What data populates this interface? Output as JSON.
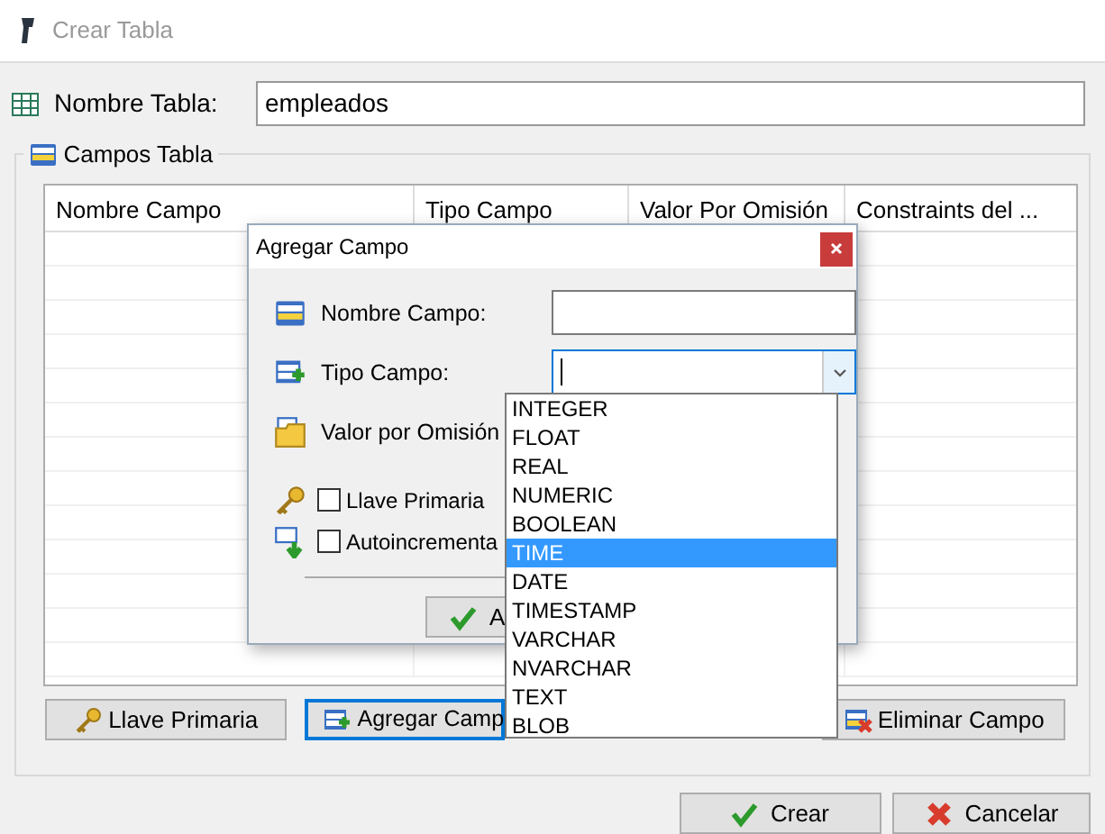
{
  "window": {
    "title": "Crear Tabla",
    "active": false
  },
  "table_name": {
    "label": "Nombre Tabla:",
    "value": "empleados"
  },
  "fields_group": {
    "title": "Campos Tabla",
    "columns": [
      "Nombre Campo",
      "Tipo Campo",
      "Valor Por Omisión",
      "Constraints del ..."
    ],
    "buttons": [
      {
        "kind": "key",
        "label": "Llave Primaria",
        "focused": false
      },
      {
        "kind": "add",
        "label": "Agregar Camp",
        "focused": true
      },
      {
        "kind": "delete",
        "label": "Eliminar Campo",
        "focused": false
      }
    ]
  },
  "buttons": [
    {
      "kind": "accept",
      "label": "Crear"
    },
    {
      "kind": "cancel",
      "label": "Cancelar"
    }
  ],
  "dialog": {
    "title": "Agregar Campo",
    "fields": [
      {
        "kind": "text",
        "label": "Nombre Campo:"
      },
      {
        "kind": "combo",
        "label": "Tipo Campo:",
        "expanded": true
      },
      {
        "kind": "default",
        "label": "Valor por Omisión"
      }
    ],
    "checkboxes": [
      {
        "kind": "key",
        "label": "Llave Primaria",
        "checked": false
      },
      {
        "kind": "auto",
        "label": "Autoincrementa",
        "checked": false
      }
    ],
    "button": {
      "label": "A"
    },
    "options": [
      {
        "label": "INTEGER",
        "selected": false
      },
      {
        "label": "FLOAT",
        "selected": false
      },
      {
        "label": "REAL",
        "selected": false
      },
      {
        "label": "NUMERIC",
        "selected": false
      },
      {
        "label": "BOOLEAN",
        "selected": false
      },
      {
        "label": "TIME",
        "selected": true
      },
      {
        "label": "DATE",
        "selected": false
      },
      {
        "label": "TIMESTAMP",
        "selected": false
      },
      {
        "label": "VARCHAR",
        "selected": false
      },
      {
        "label": "NVARCHAR",
        "selected": false
      },
      {
        "label": "TEXT",
        "selected": false
      },
      {
        "label": "BLOB",
        "selected": false
      }
    ]
  }
}
